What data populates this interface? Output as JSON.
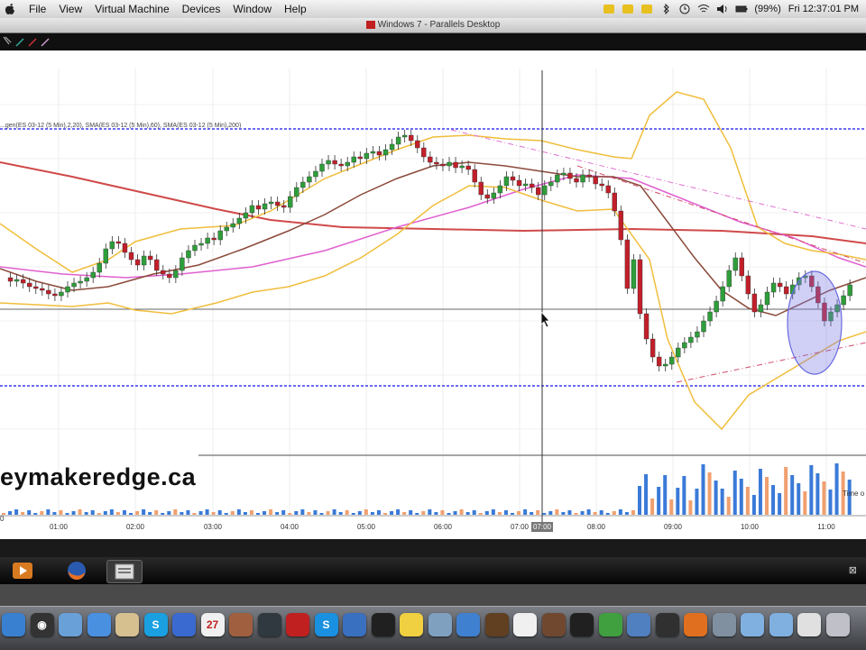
{
  "menubar": {
    "items": [
      "File",
      "View",
      "Virtual Machine",
      "Devices",
      "Window",
      "Help"
    ],
    "battery": "(99%)",
    "clock": "Fri 12:37:01 PM"
  },
  "window": {
    "title": "Windows 7 - Parallels Desktop"
  },
  "chart": {
    "indicator_label": "...gen(ES 03-12 (5 Min),2,20), SMA(ES 03-12 (5 Min),60), SMA(ES 03-12 (5 Min),200)",
    "watermark": "eymakeredge.ca",
    "time_label": "Time o",
    "volume_label": "0",
    "crosshair_time": "07:00",
    "colors": {
      "up_candle": "#2e9e3a",
      "down_candle": "#c21f2a",
      "bollinger": "#f0be3c",
      "sma_fast": "#8b4a3a",
      "sma_mid": "#e060d0",
      "sma_slow": "#d04a4a",
      "level_line": "#3a3af0",
      "volume_blue": "#3a7ad8",
      "volume_orange": "#f0a070"
    }
  },
  "chart_data": {
    "type": "candlestick",
    "x_tick_labels": [
      "01:00",
      "02:00",
      "03:00",
      "04:00",
      "05:00",
      "06:00",
      "07:00",
      "08:00",
      "09:00",
      "10:00",
      "11:00"
    ]
  },
  "taskbar": {
    "close_glyph": "⊠"
  },
  "dock": {
    "icons": [
      {
        "name": "finder-icon",
        "color": "#3a80d0",
        "glyph": ""
      },
      {
        "name": "dashboard-icon",
        "color": "#333",
        "glyph": "◉"
      },
      {
        "name": "mail-icon",
        "color": "#6aa0d8",
        "glyph": ""
      },
      {
        "name": "safari-icon",
        "color": "#4a90e0",
        "glyph": ""
      },
      {
        "name": "notes-icon",
        "color": "#d6c090",
        "glyph": ""
      },
      {
        "name": "skype-icon",
        "color": "#1aa0e0",
        "glyph": "S"
      },
      {
        "name": "itunes-icon",
        "color": "#3a6ad0",
        "glyph": ""
      },
      {
        "name": "calendar-icon",
        "color": "#f0f0f0",
        "glyph": "27"
      },
      {
        "name": "photos-icon",
        "color": "#a06040",
        "glyph": ""
      },
      {
        "name": "monitor-icon",
        "color": "#303840",
        "glyph": ""
      },
      {
        "name": "parallels-icon",
        "color": "#c02020",
        "glyph": ""
      },
      {
        "name": "skype2-icon",
        "color": "#1a90e0",
        "glyph": "S"
      },
      {
        "name": "network-icon",
        "color": "#3a70c0",
        "glyph": ""
      },
      {
        "name": "activity-icon",
        "color": "#202020",
        "glyph": ""
      },
      {
        "name": "stickies-icon",
        "color": "#f0d040",
        "glyph": ""
      },
      {
        "name": "tools-icon",
        "color": "#80a0c0",
        "glyph": ""
      },
      {
        "name": "download-icon",
        "color": "#4080d0",
        "glyph": ""
      },
      {
        "name": "star-icon",
        "color": "#604020",
        "glyph": ""
      },
      {
        "name": "paper-icon",
        "color": "#f0f0f0",
        "glyph": ""
      },
      {
        "name": "preview-icon",
        "color": "#704830",
        "glyph": ""
      },
      {
        "name": "photobooth-icon",
        "color": "#202020",
        "glyph": ""
      },
      {
        "name": "facetime-icon",
        "color": "#40a040",
        "glyph": ""
      },
      {
        "name": "world-icon",
        "color": "#5080c0",
        "glyph": ""
      },
      {
        "name": "camera-icon",
        "color": "#303030",
        "glyph": ""
      },
      {
        "name": "firefox-icon",
        "color": "#e07020",
        "glyph": ""
      },
      {
        "name": "system-prefs-icon",
        "color": "#8090a0",
        "glyph": ""
      },
      {
        "name": "folder-icon",
        "color": "#80b0e0",
        "glyph": ""
      },
      {
        "name": "folder2-icon",
        "color": "#80b0e0",
        "glyph": ""
      },
      {
        "name": "doc-icon",
        "color": "#e0e0e0",
        "glyph": ""
      },
      {
        "name": "trash-icon",
        "color": "#c0c0c8",
        "glyph": ""
      }
    ]
  }
}
